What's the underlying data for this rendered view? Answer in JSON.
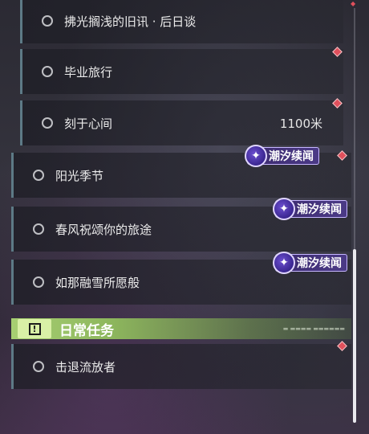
{
  "quests": [
    {
      "label": "拂光搁浅的旧讯 · 后日谈",
      "distance": ""
    },
    {
      "label": "毕业旅行",
      "distance": ""
    },
    {
      "label": "刻于心间",
      "distance": "1100米"
    },
    {
      "label": "阳光季节",
      "distance": ""
    },
    {
      "label": "春风祝颂你的旅途",
      "distance": ""
    },
    {
      "label": "如那融雪所愿般",
      "distance": ""
    }
  ],
  "badges": [
    {
      "label": "潮汐续闻",
      "icon": "tide-star-icon"
    },
    {
      "label": "潮汐续闻",
      "icon": "tide-star-icon"
    },
    {
      "label": "潮汐续闻",
      "icon": "tide-star-icon"
    }
  ],
  "daily_section": {
    "title": "日常任务",
    "icon": "exclamation-icon",
    "tail_text": "▬ ▬▬▬▬ ▬▬▬▬▬▬"
  },
  "daily_quests": [
    {
      "label": "击退流放者"
    }
  ],
  "colors": {
    "accent_green": "#a7cf72",
    "badge_purple": "#4b3a86",
    "marker_red": "#e0505c",
    "quest_border": "#5d7a86"
  }
}
